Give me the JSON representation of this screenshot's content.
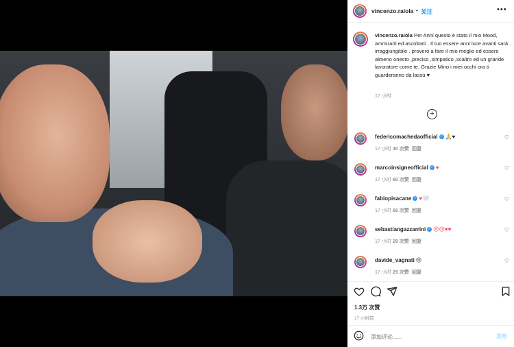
{
  "header": {
    "username": "vincenzo.raiola",
    "follow_label": "关注",
    "separator": "•",
    "more_label": "•••"
  },
  "caption": {
    "username": "vincenzo.raiola",
    "text": "Per Anni questo è stato il mio Mood, ammirarti ed ascoltarti . Il tuo essere anni luce avanti sarà irraggiungibile . proverò a fare il mio meglio ed essere almeno onesto ,preciso ,simpatico ,scaltro ed un grande lavoratore come te. Grazie Mino i miei occhi ora ti guarderanno da lassù ♥",
    "time": "17 小时"
  },
  "comments": [
    {
      "username": "federicomachedaofficial",
      "emoji": "🙏♥",
      "time": "17 小时",
      "likes": "30 次赞",
      "reply": "回复"
    },
    {
      "username": "marcoinsigneofficial",
      "emoji": "♥",
      "time": "17 小时",
      "likes": "60 次赞",
      "reply": "回复"
    },
    {
      "username": "fabiopisacane",
      "emoji": "♥🤍",
      "time": "17 小时",
      "likes": "66 次赞",
      "reply": "回复"
    },
    {
      "username": "sebastiangazzarrini",
      "emoji": "😢😢♥♥",
      "time": "17 小时",
      "likes": "29 次赞",
      "reply": "回复"
    },
    {
      "username": "davide_vagnati",
      "emoji": "😢",
      "time": "17 小时",
      "likes": "29 次赞",
      "reply": "回复"
    }
  ],
  "stats": {
    "likes": "1.3万 次赞",
    "time": "17 小时前"
  },
  "composer": {
    "placeholder": "添加评论......",
    "post_label": "发布"
  },
  "colors": {
    "accent": "#0095f6",
    "verified": "#3897f0",
    "heart": "#ed4956"
  }
}
